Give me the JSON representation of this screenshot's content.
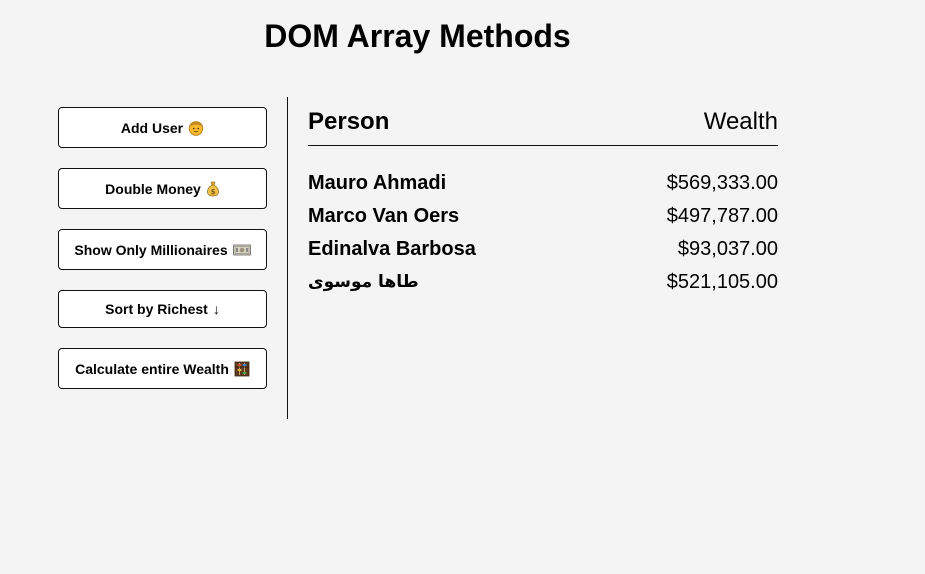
{
  "header": {
    "title": "DOM Array Methods"
  },
  "sidebar": {
    "buttons": [
      {
        "label": "Add User",
        "icon": "user-face-icon"
      },
      {
        "label": "Double Money",
        "icon": "money-bag-icon"
      },
      {
        "label": "Show Only Millionaires",
        "icon": "banknote-icon"
      },
      {
        "label": "Sort by Richest",
        "icon": "arrow-down-icon",
        "icon_text": "↓"
      },
      {
        "label": "Calculate entire Wealth",
        "icon": "abacus-icon"
      }
    ]
  },
  "table": {
    "headers": {
      "person": "Person",
      "wealth": "Wealth"
    },
    "rows": [
      {
        "name": "Mauro Ahmadi",
        "wealth": "$569,333.00"
      },
      {
        "name": "Marco Van Oers",
        "wealth": "$497,787.00"
      },
      {
        "name": "Edinalva Barbosa",
        "wealth": "$93,037.00"
      },
      {
        "name": "طاها موسوی",
        "wealth": "$521,105.00"
      }
    ]
  },
  "colors": {
    "background": "#f4f4f4",
    "button_bg": "#ffffff",
    "border": "#111111",
    "emoji_yellow": "#f5b82e",
    "emoji_outline": "#b07a10"
  }
}
